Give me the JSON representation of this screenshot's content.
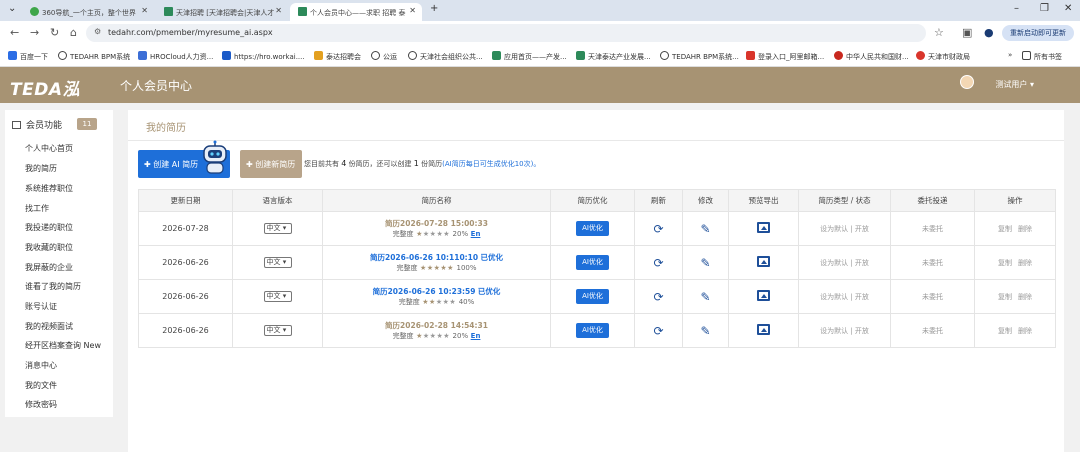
{
  "browser": {
    "tabs": [
      {
        "label": "360导航_一个主页，整个世界"
      },
      {
        "label": "天津招聘 [天津招聘会|天津人才"
      },
      {
        "label": "个人会员中心——求职 招聘 泰"
      }
    ],
    "new_tab": "+",
    "url": "tedahr.com/pmember/myresume_ai.aspx",
    "restart_label": "重新启动即可更新",
    "bookmarks": [
      "百度一下",
      "TEDAHR BPM系统",
      "HROCloud人力资...",
      "https://hro.workai....",
      "泰达招聘会",
      "公运",
      "天津社会组织公共...",
      "应用首页——产发...",
      "天津泰达产业发展...",
      "TEDAHR BPM系统...",
      "登录入口_阿里邮箱...",
      "中华人民共和国财...",
      "天津市财政局"
    ],
    "all_bookmarks": "所有书签",
    "colors": {
      "tabbar": "#dbe3ee",
      "accent": "#1a3b73"
    }
  },
  "header": {
    "logo": "TEDA泓",
    "title": "个人会员中心",
    "user": "测试用户",
    "color": "#a79373"
  },
  "sidebar": {
    "title": "会员功能",
    "badge": "11",
    "items": [
      "个人中心首页",
      "我的简历",
      "系统推荐职位",
      "找工作",
      "我投递的职位",
      "我收藏的职位",
      "我屏蔽的企业",
      "谁看了我的简历",
      "账号认证",
      "我的视频面试",
      "经开区档案查询 New",
      "消息中心",
      "我的文件",
      "修改密码"
    ]
  },
  "main": {
    "title": "我的简历",
    "create_ai_button": "创建 AI 简历",
    "create_new_button": "创建新简历",
    "tip_prefix": "您目前共有",
    "tip_count": "4",
    "tip_mid": "份简历，还可以创建",
    "tip_left": "1",
    "tip_suffix": "份简历",
    "tip_blue": "(AI简历每日可生成优化10次)。",
    "columns": [
      "更新日期",
      "语言版本",
      "简历名称",
      "简历优化",
      "刷新",
      "修改",
      "预览导出",
      "简历类型 / 状态",
      "委托投递",
      "操作"
    ],
    "rows": [
      {
        "date": "2026-07-28",
        "lang": "中文",
        "name": "简历2026-07-28 15:00:33",
        "name_style": "tan",
        "optimized": "",
        "completeness_label": "完整度",
        "stars": 1,
        "percent": "20%",
        "en": "En",
        "ai_label": "AI优化",
        "type_status": "设为默认 | 开放",
        "delegate": "未委托",
        "copy": "复制",
        "delete": "删除"
      },
      {
        "date": "2026-06-26",
        "lang": "中文",
        "name": "简历2026-06-26 10:110:10",
        "name_style": "blu",
        "optimized": "已优化",
        "completeness_label": "完整度",
        "stars": 5,
        "percent": "100%",
        "en": "",
        "ai_label": "AI优化",
        "type_status": "设为默认 | 开放",
        "delegate": "未委托",
        "copy": "复制",
        "delete": "删除"
      },
      {
        "date": "2026-06-26",
        "lang": "中文",
        "name": "简历2026-06-26 10:23:59",
        "name_style": "blu",
        "optimized": "已优化",
        "completeness_label": "完整度",
        "stars": 2,
        "percent": "40%",
        "en": "",
        "ai_label": "AI优化",
        "type_status": "设为默认 | 开放",
        "delegate": "未委托",
        "copy": "复制",
        "delete": "删除"
      },
      {
        "date": "2026-06-26",
        "lang": "中文",
        "name": "简历2026-02-28 14:54:31",
        "name_style": "tan",
        "optimized": "",
        "completeness_label": "完整度",
        "stars": 1,
        "percent": "20%",
        "en": "En",
        "ai_label": "AI优化",
        "type_status": "设为默认 | 开放",
        "delegate": "未委托",
        "copy": "复制",
        "delete": "删除"
      }
    ]
  }
}
